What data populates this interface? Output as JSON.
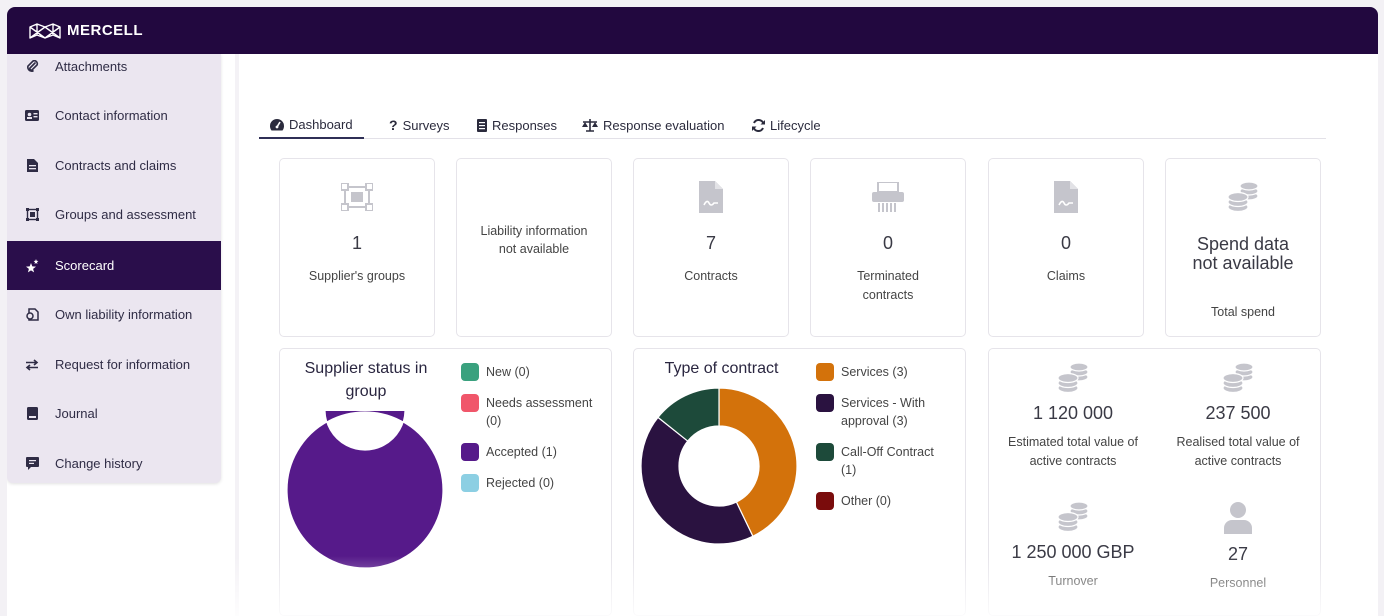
{
  "brand": {
    "name": "MERCELL",
    "color": "#22083f"
  },
  "sidebar": {
    "items": [
      {
        "label": "Attachments",
        "icon": "paperclip-icon"
      },
      {
        "label": "Contact information",
        "icon": "id-card-icon"
      },
      {
        "label": "Contracts and claims",
        "icon": "document-icon"
      },
      {
        "label": "Groups and assessment",
        "icon": "group-icon"
      },
      {
        "label": "Scorecard",
        "icon": "stars-icon",
        "active": true
      },
      {
        "label": "Own liability information",
        "icon": "liability-icon"
      },
      {
        "label": "Request for information",
        "icon": "arrows-icon"
      },
      {
        "label": "Journal",
        "icon": "book-icon"
      },
      {
        "label": "Change history",
        "icon": "comment-icon"
      }
    ]
  },
  "tabs": [
    {
      "label": "Dashboard",
      "icon": "gauge-icon",
      "active": true
    },
    {
      "label": "Surveys",
      "icon": "question-icon"
    },
    {
      "label": "Responses",
      "icon": "list-icon"
    },
    {
      "label": "Response evaluation",
      "icon": "scale-icon"
    },
    {
      "label": "Lifecycle",
      "icon": "refresh-icon"
    }
  ],
  "cards": {
    "groups": {
      "value": "1",
      "label": "Supplier's groups"
    },
    "liability": {
      "text_line1": "Liability information",
      "text_line2": "not available"
    },
    "contracts": {
      "value": "7",
      "label": "Contracts"
    },
    "terminated": {
      "value": "0",
      "label_line1": "Terminated",
      "label_line2": "contracts"
    },
    "claims": {
      "value": "0",
      "label": "Claims"
    },
    "spend": {
      "text_line1": "Spend data",
      "text_line2": "not available",
      "label": "Total spend"
    }
  },
  "supplier_status": {
    "title_line1": "Supplier status in",
    "title_line2": "group",
    "legend": [
      {
        "label_line1": "New (0)",
        "label_line2": "",
        "color": "#3aa17e"
      },
      {
        "label_line1": "Needs assessment",
        "label_line2": "(0)",
        "color": "#f0566a"
      },
      {
        "label_line1": "Accepted (1)",
        "label_line2": "",
        "color": "#561a8a"
      },
      {
        "label_line1": "Rejected (0)",
        "label_line2": "",
        "color": "#8ccfe3"
      }
    ]
  },
  "contract_type": {
    "title": "Type of contract",
    "legend": [
      {
        "label_line1": "Services (3)",
        "label_line2": "",
        "color": "#d3720b"
      },
      {
        "label_line1": "Services - With",
        "label_line2": "approval (3)",
        "color": "#2a1240"
      },
      {
        "label_line1": "Call-Off Contract",
        "label_line2": "(1)",
        "color": "#1d4a3a"
      },
      {
        "label_line1": "Other (0)",
        "label_line2": "",
        "color": "#7a0c0c"
      }
    ]
  },
  "chart_data": [
    {
      "type": "pie",
      "title": "Supplier status in group",
      "categories": [
        "New",
        "Needs assessment",
        "Accepted",
        "Rejected"
      ],
      "values": [
        0,
        0,
        1,
        0
      ],
      "colors": [
        "#3aa17e",
        "#f0566a",
        "#561a8a",
        "#8ccfe3"
      ]
    },
    {
      "type": "pie",
      "title": "Type of contract",
      "categories": [
        "Services",
        "Services - With approval",
        "Call-Off Contract",
        "Other"
      ],
      "values": [
        3,
        3,
        1,
        0
      ],
      "colors": [
        "#d3720b",
        "#2a1240",
        "#1d4a3a",
        "#7a0c0c"
      ]
    }
  ],
  "metrics": {
    "estimated": {
      "value": "1 120 000",
      "label_line1": "Estimated total value of",
      "label_line2": "active contracts"
    },
    "realised": {
      "value": "237 500",
      "label_line1": "Realised total value of",
      "label_line2": "active contracts"
    },
    "turnover": {
      "value": "1 250 000 GBP",
      "label": "Turnover"
    },
    "personnel": {
      "value": "27",
      "label": "Personnel"
    }
  }
}
